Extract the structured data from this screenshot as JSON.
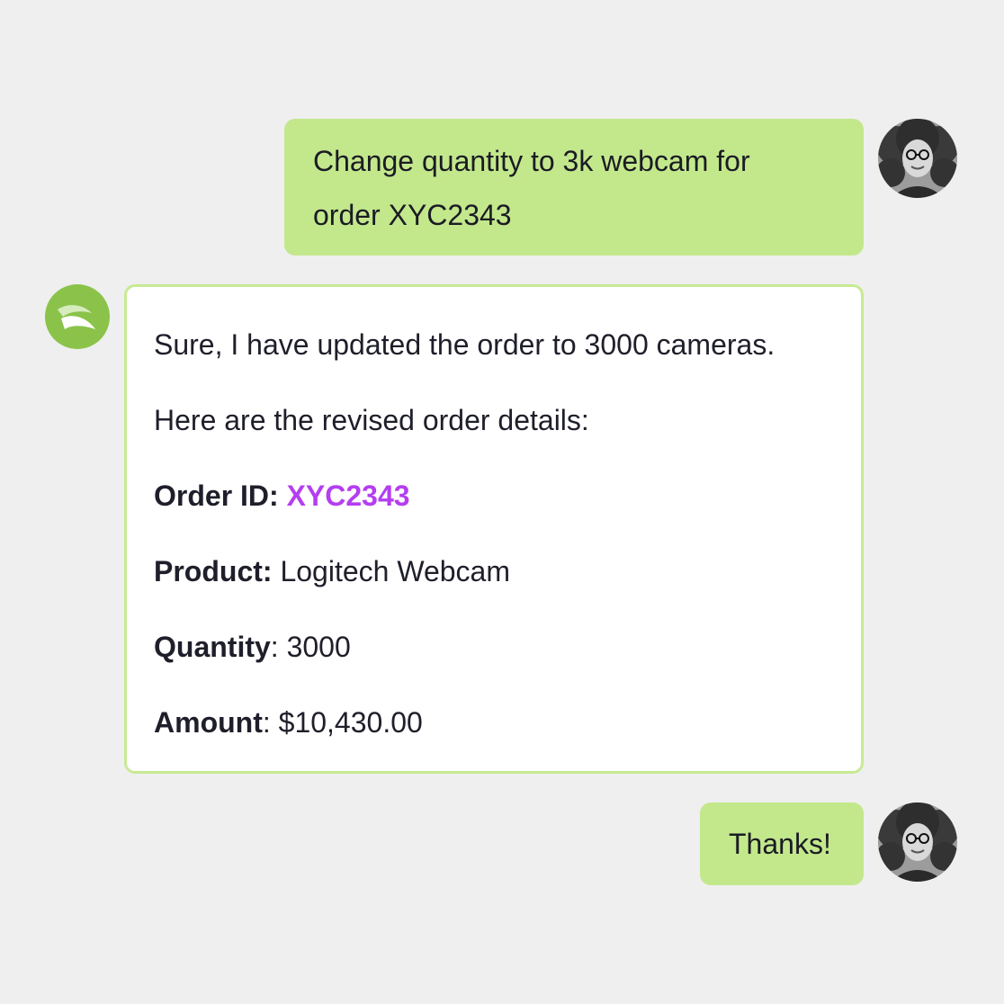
{
  "conversation": {
    "user_message_1": {
      "line1": "Change quantity to 3k webcam for",
      "line2": "order XYC2343"
    },
    "bot_message": {
      "intro": "Sure, I have updated the order to 3000 cameras.",
      "details_heading": "Here are the revised order details:",
      "order_id_label": "Order ID:",
      "order_id_value": "XYC2343",
      "product_label": "Product:",
      "product_value": "Logitech Webcam",
      "quantity_label": "Quantity",
      "quantity_value": ": 3000",
      "amount_label": "Amount",
      "amount_value": ": $10,430.00"
    },
    "user_message_2": {
      "text": "Thanks!"
    }
  },
  "colors": {
    "background": "#efefef",
    "user_bubble": "#c3e88c",
    "bot_border": "#c7ea93",
    "bot_logo": "#8bc34a",
    "order_id_accent": "#b43ef0"
  },
  "icons": {
    "user_avatar": "user-avatar-photo",
    "bot_avatar": "bot-logo-icon"
  }
}
